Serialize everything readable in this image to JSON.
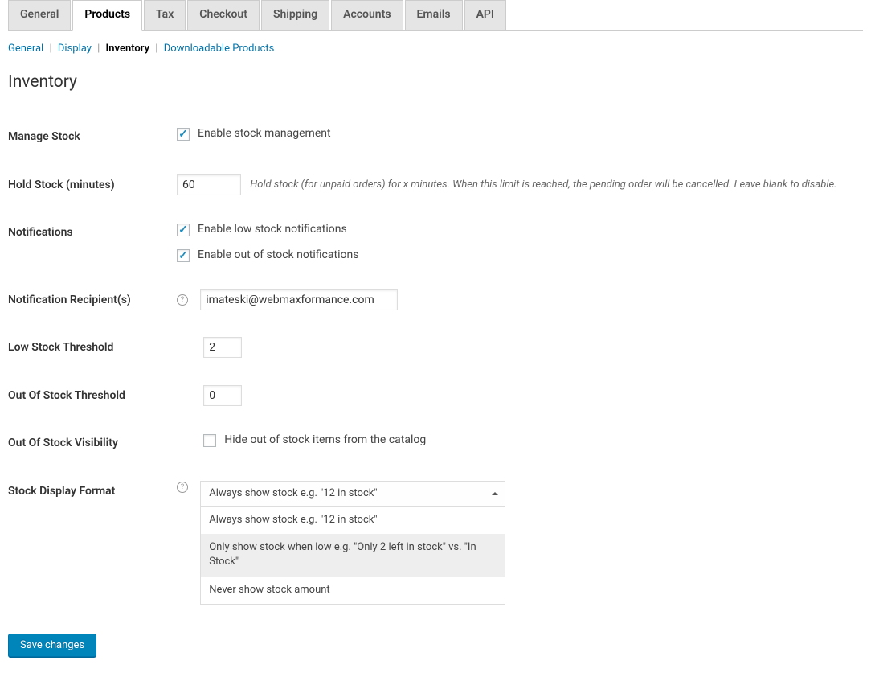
{
  "tabs": {
    "general": "General",
    "products": "Products",
    "tax": "Tax",
    "checkout": "Checkout",
    "shipping": "Shipping",
    "accounts": "Accounts",
    "emails": "Emails",
    "api": "API"
  },
  "subtabs": {
    "general": "General",
    "display": "Display",
    "inventory": "Inventory",
    "downloadable": "Downloadable Products"
  },
  "section_title": "Inventory",
  "labels": {
    "manage_stock": "Manage Stock",
    "hold_stock": "Hold Stock (minutes)",
    "notifications": "Notifications",
    "recipients": "Notification Recipient(s)",
    "low_threshold": "Low Stock Threshold",
    "out_threshold": "Out Of Stock Threshold",
    "out_visibility": "Out Of Stock Visibility",
    "display_format": "Stock Display Format"
  },
  "fields": {
    "enable_management_text": "Enable stock management",
    "hold_stock_value": "60",
    "hold_stock_desc": "Hold stock (for unpaid orders) for x minutes. When this limit is reached, the pending order will be cancelled. Leave blank to disable.",
    "low_stock_notif_text": "Enable low stock notifications",
    "out_stock_notif_text": "Enable out of stock notifications",
    "recipient_value": "imateski@webmaxformance.com",
    "low_threshold_value": "2",
    "out_threshold_value": "0",
    "hide_out_text": "Hide out of stock items from the catalog",
    "display_selected": "Always show stock e.g. \"12 in stock\"",
    "display_options": {
      "opt1": "Always show stock e.g. \"12 in stock\"",
      "opt2": "Only show stock when low e.g. \"Only 2 left in stock\" vs. \"In Stock\"",
      "opt3": "Never show stock amount"
    }
  },
  "save_button": "Save changes"
}
